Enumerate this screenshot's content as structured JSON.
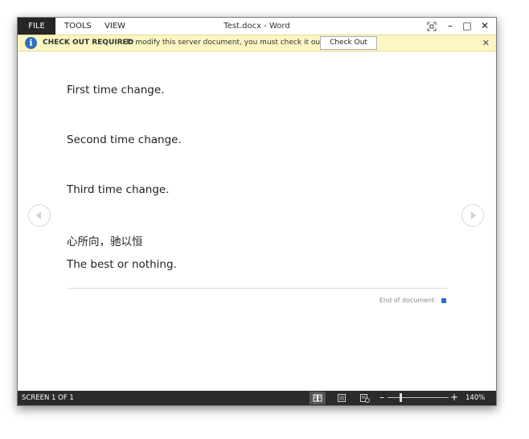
{
  "menu": {
    "file": "FILE",
    "tools": "TOOLS",
    "view": "VIEW"
  },
  "window": {
    "title": "Test.docx - Word"
  },
  "window_controls": {
    "minimize": "–",
    "maximize": "□",
    "close": "✕"
  },
  "message_bar": {
    "title": "CHECK OUT REQUIRED",
    "text": "To modify this server document, you must check it out.",
    "button": "Check Out",
    "close": "✕"
  },
  "document": {
    "paragraphs": [
      "First time change.",
      "Second time change.",
      "Third time change.",
      "心所向，驰以恒",
      "The best or nothing."
    ],
    "end_label": "End of document"
  },
  "statusbar": {
    "screen": "SCREEN 1 OF 1",
    "zoom": "140%",
    "zoom_minus": "–",
    "zoom_plus": "+"
  },
  "colors": {
    "accent": "#2b6cc4",
    "message_bg": "#fdf6c3",
    "status_bg": "#2b2b2b"
  }
}
